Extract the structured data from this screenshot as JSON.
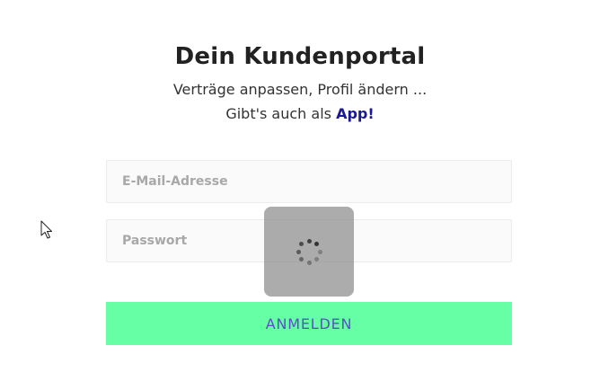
{
  "portal": {
    "title": "Dein Kundenportal",
    "subtitle_line1": "Verträge anpassen, Profil ändern ...",
    "subtitle_line2_prefix": "Gibt's auch als",
    "app_link": "App!"
  },
  "form": {
    "email_placeholder": "E-Mail-Adresse",
    "password_placeholder": "Passwort",
    "submit_label": "ANMELDEN"
  },
  "loader": {
    "icon": "spinner-icon",
    "visible": true
  },
  "cursor": {
    "icon": "arrow-cursor-icon"
  },
  "colors": {
    "button_background": "#66ffa6",
    "button_text": "#5a4fc7",
    "link": "#1a1a8f",
    "field_background": "#fafafa",
    "placeholder": "#a8a8a8"
  }
}
